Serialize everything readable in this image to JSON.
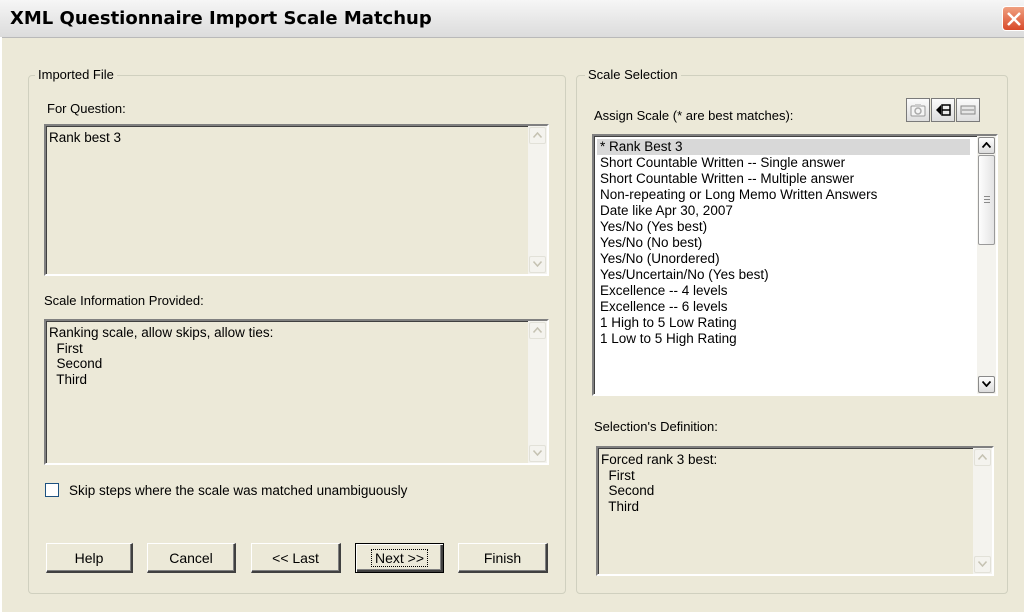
{
  "window": {
    "title": "XML Questionnaire Import Scale Matchup"
  },
  "imported_file": {
    "legend": "Imported File",
    "question_label": "For Question:",
    "question_text": "Rank best 3",
    "scale_info_label": "Scale Information Provided:",
    "scale_info_text": "Ranking scale, allow skips, allow ties:\n  First\n  Second\n  Third",
    "skip_checkbox": {
      "label": "Skip steps where the scale was matched unambiguously",
      "checked": false
    }
  },
  "buttons": {
    "help": "Help",
    "cancel": "Cancel",
    "last": "<< Last",
    "next": "Next >>",
    "finish": "Finish"
  },
  "scale_selection": {
    "legend": "Scale Selection",
    "assign_label": "Assign Scale (* are best matches):",
    "toolbar_icons": [
      "photo-icon",
      "tag-arrow-icon",
      "equals-icon"
    ],
    "scales": [
      "* Rank Best 3",
      "Short Countable Written -- Single answer",
      "Short Countable Written -- Multiple answer",
      "Non-repeating or Long Memo Written Answers",
      "Date like Apr 30, 2007",
      "Yes/No (Yes best)",
      "Yes/No (No best)",
      "Yes/No (Unordered)",
      "Yes/Uncertain/No (Yes best)",
      "Excellence -- 4 levels",
      "Excellence -- 6 levels",
      "1 High to 5 Low Rating",
      "1 Low to 5 High Rating"
    ],
    "selected_index": 0,
    "definition_label": "Selection's Definition:",
    "definition_text": "Forced rank 3 best:\n  First\n  Second\n  Third"
  },
  "colors": {
    "dialog_bg": "#ece9d8",
    "close_button": "#d94a2a",
    "selection": "#d8d8d8"
  }
}
